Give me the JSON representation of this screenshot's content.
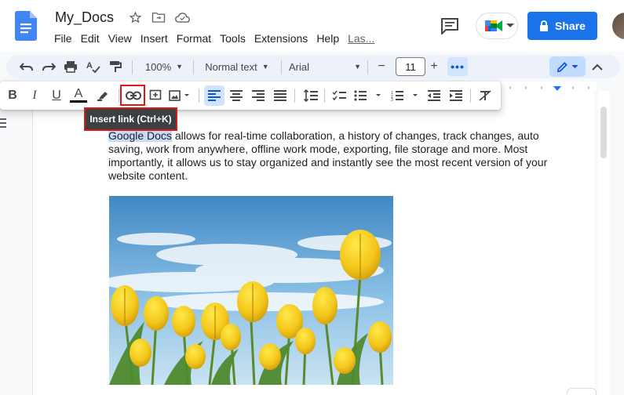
{
  "header": {
    "title": "My_Docs",
    "menus": [
      "File",
      "Edit",
      "View",
      "Insert",
      "Format",
      "Tools",
      "Extensions",
      "Help",
      "Las..."
    ],
    "share_label": "Share",
    "icons": [
      "star-icon",
      "move-folder-icon",
      "cloud-status-icon",
      "comment-icon",
      "meet-icon"
    ]
  },
  "toolbar": {
    "zoom": "100%",
    "style": "Normal text",
    "font": "Arial",
    "font_size": "11",
    "minus": "−",
    "plus": "+",
    "more": "•••"
  },
  "format_toolbar": {
    "bold": "B",
    "italic": "I",
    "underline": "U",
    "text_color": "A",
    "tooltip": "Insert link (Ctrl+K)"
  },
  "document": {
    "highlighted": "Google Docs",
    "paragraph": " allows for real-time collaboration, a history of changes, track changes, auto saving, work from anywhere, offline work mode, exporting, file storage and more. Most importantly, it allows us to stay organized and instantly see the most recent version of your website content."
  },
  "colors": {
    "share_blue": "#1a73e8",
    "selection": "#c7dbf7",
    "annotation_red": "#e01717",
    "toolbar_bg": "#edf2fa"
  }
}
